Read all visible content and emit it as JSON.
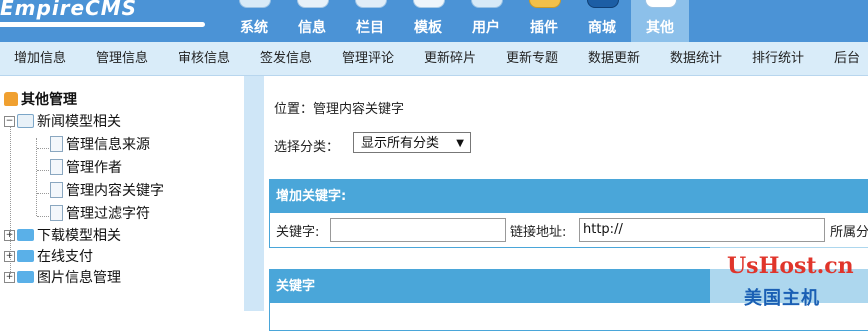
{
  "header": {
    "logo_text": "EmpireCMS",
    "nav": [
      {
        "label": "系统",
        "icon": "system-icon"
      },
      {
        "label": "信息",
        "icon": "info-icon"
      },
      {
        "label": "栏目",
        "icon": "column-icon"
      },
      {
        "label": "模板",
        "icon": "template-icon"
      },
      {
        "label": "用户",
        "icon": "user-icon"
      },
      {
        "label": "插件",
        "icon": "plugin-icon"
      },
      {
        "label": "商城",
        "icon": "shop-icon"
      },
      {
        "label": "其他",
        "icon": "other-icon"
      }
    ],
    "active_nav": "其他"
  },
  "subnav": [
    "增加信息",
    "管理信息",
    "审核信息",
    "签发信息",
    "管理评论",
    "更新碎片",
    "更新专题",
    "数据更新",
    "数据统计",
    "排行统计",
    "后台"
  ],
  "sidebar": {
    "root": "其他管理",
    "groups": [
      {
        "label": "新闻模型相关",
        "expanded": true,
        "children": [
          "管理信息来源",
          "管理作者",
          "管理内容关键字",
          "管理过滤字符"
        ]
      },
      {
        "label": "下载模型相关",
        "expanded": false
      },
      {
        "label": "在线支付",
        "expanded": false
      },
      {
        "label": "图片信息管理",
        "expanded": false
      }
    ]
  },
  "main": {
    "breadcrumb": "位置：管理内容关键字",
    "category_label": "选择分类：",
    "category_value": "显示所有分类",
    "add_panel_title": "增加关键字:",
    "keyword_label": "关键字:",
    "keyword_value": "",
    "link_label": "链接地址:",
    "link_value": "http://",
    "category_field_label": "所属分",
    "list_panel_title": "关键字"
  },
  "watermark": {
    "line1": "UsHost.cn",
    "line2": "美国主机"
  },
  "colors": {
    "header": "#4b93d6",
    "active_tab": "#8cc0ea",
    "subbar": "#d9ecf9",
    "panel_header": "#4aa6d9",
    "watermark_red": "#e0352b",
    "watermark_blue": "#1a5fb4"
  }
}
